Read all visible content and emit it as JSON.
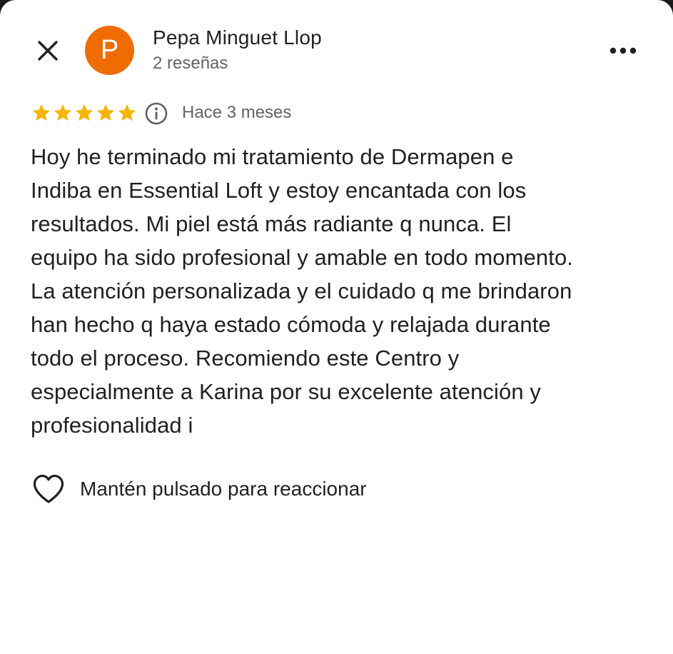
{
  "author": {
    "initial": "P",
    "name": "Pepa Minguet Llop",
    "subtitle": "2 reseñas",
    "avatar_color": "#ef6c00"
  },
  "header": {
    "close_icon": "close-icon",
    "more_icon": "more-horizontal-icon"
  },
  "review": {
    "rating": 5,
    "rating_max": 5,
    "star_color": "#f6b400",
    "time_ago": "Hace 3 meses",
    "text_lines": [
      "Hoy he terminado mi tratamiento de Dermapen e",
      "Indiba en Essential Loft y estoy encantada con los",
      "resultados. Mi piel está más radiante q nunca. El",
      "equipo ha sido profesional y amable en todo momento.",
      "La atención personalizada y el cuidado q me brindaron",
      "han hecho q haya estado cómoda y relajada durante",
      "todo el proceso. Recomiendo este Centro y",
      "especialmente a Karina por su excelente atención y",
      "profesionalidad i"
    ]
  },
  "reaction": {
    "label": "Mantén pulsado para reaccionar",
    "icon": "heart-outline-icon"
  }
}
